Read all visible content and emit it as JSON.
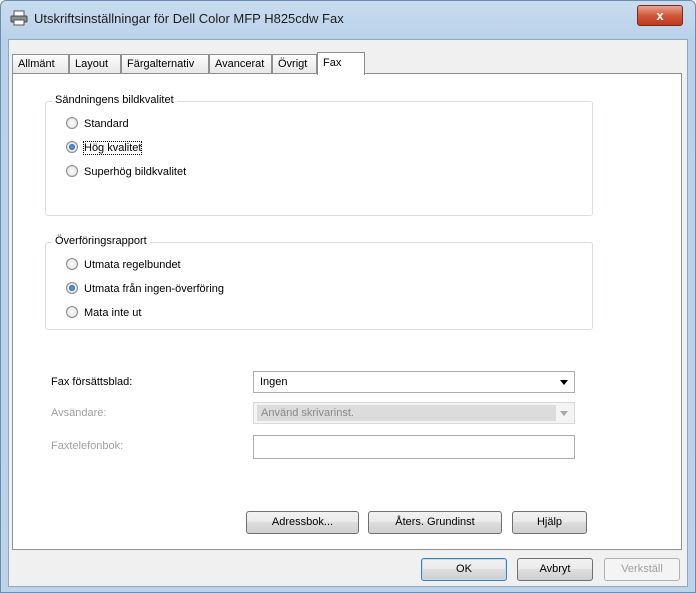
{
  "window": {
    "title": "Utskriftsinställningar för Dell Color MFP H825cdw Fax",
    "close_label": "x"
  },
  "tabs": [
    "Allmänt",
    "Layout",
    "Färgalternativ",
    "Avancerat",
    "Övrigt",
    "Fax"
  ],
  "quality_group": {
    "label": "Sändningens bildkvalitet",
    "options": [
      "Standard",
      "Hög kvalitet",
      "Superhög bildkvalitet"
    ],
    "selected": "Hög kvalitet"
  },
  "report_group": {
    "label": "Överföringsrapport",
    "options": [
      "Utmata regelbundet",
      "Utmata från ingen-överföring",
      "Mata inte ut"
    ],
    "selected": "Utmata från ingen-överföring"
  },
  "fax_cover": {
    "label": "Fax försättsblad:",
    "value": "Ingen"
  },
  "sender": {
    "label": "Avsändare:",
    "value": "Använd skrivarinst."
  },
  "phonebook": {
    "label": "Faxtelefonbok:",
    "value": ""
  },
  "page_buttons": {
    "addressbook": "Adressbok...",
    "restore": "Åters. Grundinst",
    "help": "Hjälp"
  },
  "dialog_buttons": {
    "ok": "OK",
    "cancel": "Avbryt",
    "apply": "Verkställ"
  }
}
